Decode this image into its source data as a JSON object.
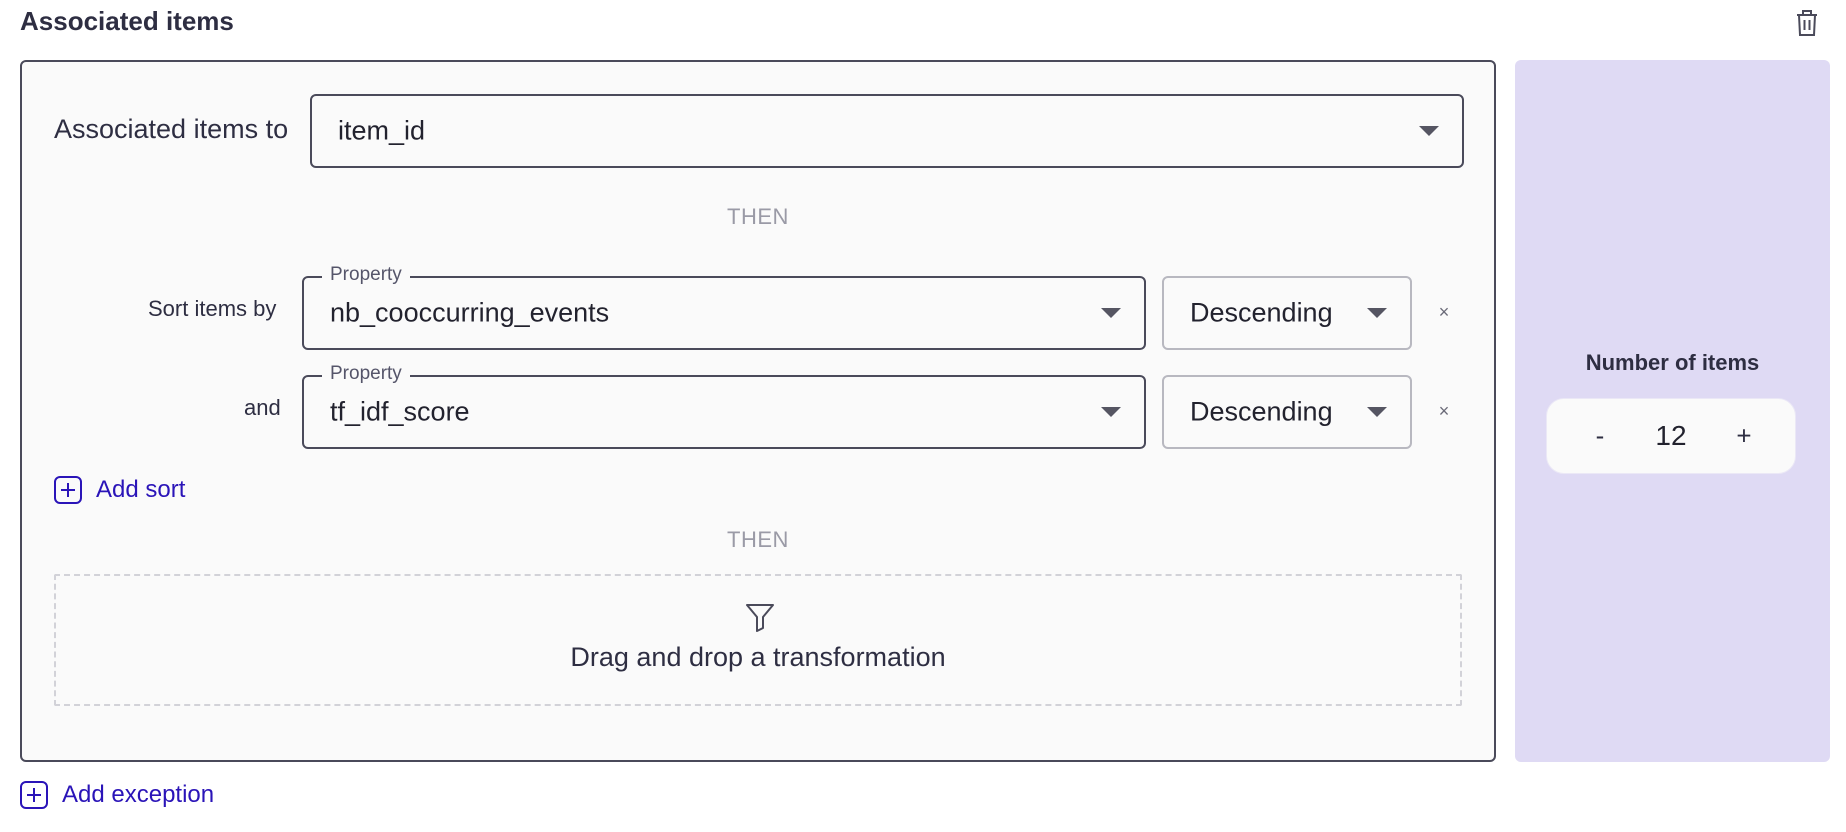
{
  "header": {
    "title": "Associated items",
    "delete_icon": "trash-icon"
  },
  "association": {
    "label": "Associated items to",
    "selected": "item_id"
  },
  "then_label": "THEN",
  "sorts": [
    {
      "prefix": "Sort items by",
      "legend": "Property",
      "property": "nb_cooccurring_events",
      "order": "Descending",
      "remove": "×"
    },
    {
      "prefix": "and",
      "legend": "Property",
      "property": "tf_idf_score",
      "order": "Descending",
      "remove": "×"
    }
  ],
  "add_sort_label": "Add sort",
  "dropzone": {
    "icon": "filter-icon",
    "text": "Drag and drop a transformation"
  },
  "add_exception_label": "Add exception",
  "number_of_items": {
    "title": "Number of items",
    "decrement": "-",
    "value": "12",
    "increment": "+"
  },
  "colors": {
    "accent": "#2a14b8",
    "side_panel": "#dfdaf4"
  }
}
